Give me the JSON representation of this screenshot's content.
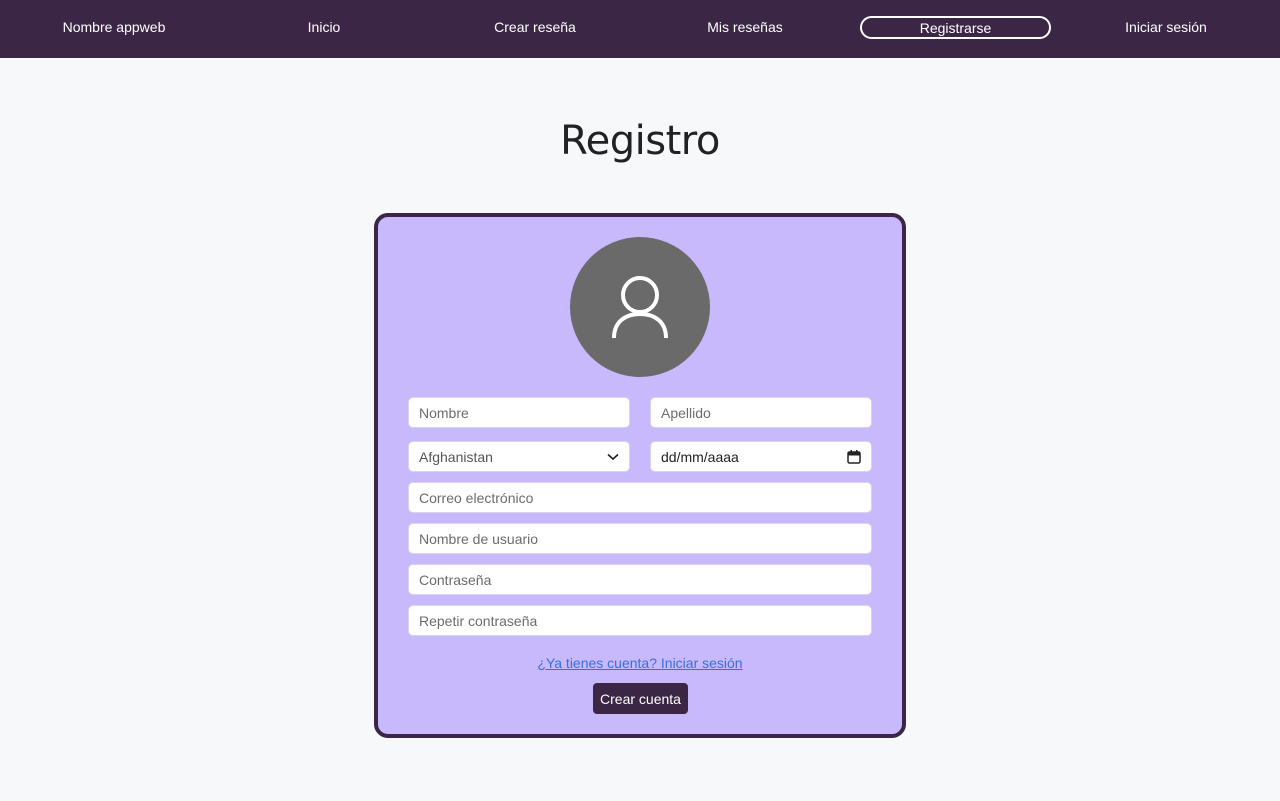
{
  "nav": {
    "brand": "Nombre appweb",
    "items": [
      {
        "label": "Inicio"
      },
      {
        "label": "Crear reseña"
      },
      {
        "label": "Mis reseñas"
      },
      {
        "label": "Registrarse",
        "active": true
      },
      {
        "label": "Iniciar sesión"
      }
    ]
  },
  "page": {
    "title": "Registro"
  },
  "form": {
    "avatar_icon": "user-icon",
    "first_name": {
      "placeholder": "Nombre",
      "value": ""
    },
    "last_name": {
      "placeholder": "Apellido",
      "value": ""
    },
    "country": {
      "selected": "Afghanistan"
    },
    "birthdate": {
      "placeholder": "dd/mm/aaaa"
    },
    "email": {
      "placeholder": "Correo electrónico",
      "value": ""
    },
    "username": {
      "placeholder": "Nombre de usuario",
      "value": ""
    },
    "password": {
      "placeholder": "Contraseña",
      "value": ""
    },
    "repeat_password": {
      "placeholder": "Repetir contraseña",
      "value": ""
    },
    "login_link": "¿Ya tienes cuenta? Iniciar sesión",
    "submit_label": "Crear cuenta"
  },
  "colors": {
    "navbar": "#3c2645",
    "card": "#c8b8fc",
    "card_border": "#3c2645",
    "avatar": "#6a6a6a",
    "link": "#3a6fd8",
    "background": "#f7f8fa"
  }
}
